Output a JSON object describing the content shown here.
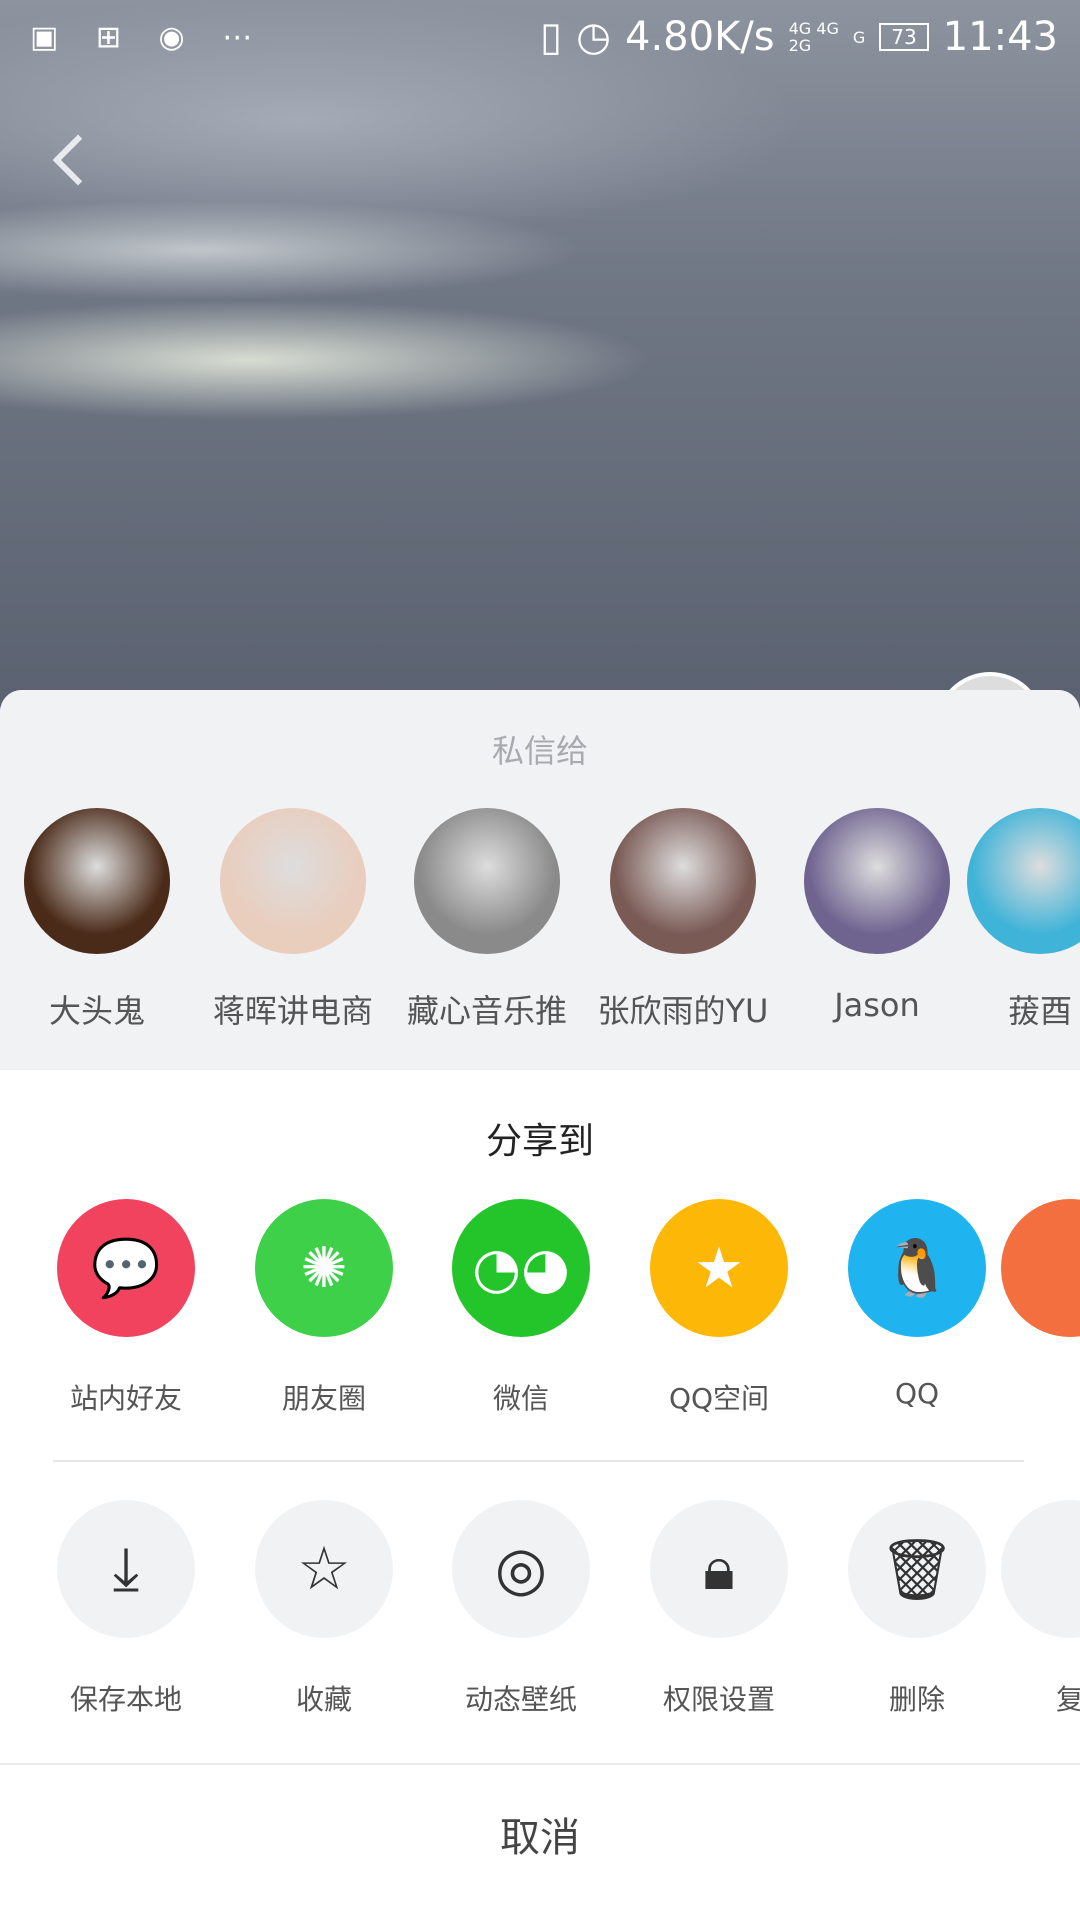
{
  "status_bar": {
    "left_icons": [
      "image-icon",
      "apps-icon",
      "record-icon",
      "more-icon"
    ],
    "speed": "4.80K/s",
    "net1": "4G 4G",
    "net2": "2G",
    "sim2": "G",
    "battery": "73",
    "time": "11:43"
  },
  "dm": {
    "title": "私信给",
    "contacts": [
      {
        "name": "大头鬼",
        "color": "#4a2a18"
      },
      {
        "name": "蒋晖讲电商",
        "color": "#e9cdbd"
      },
      {
        "name": "藏心音乐推",
        "color": "#8a8a8a"
      },
      {
        "name": "张欣雨的YU",
        "color": "#7a5a55"
      },
      {
        "name": "Jason",
        "color": "#6f6490"
      },
      {
        "name": "菝酉",
        "color": "#3fb3d8"
      }
    ]
  },
  "share": {
    "title": "分享到",
    "items": [
      {
        "label": "站内好友",
        "color": "#f2435e",
        "icon": "chat-bubble-icon"
      },
      {
        "label": "朋友圈",
        "color": "#3fd04a",
        "icon": "moments-icon"
      },
      {
        "label": "微信",
        "color": "#23c52b",
        "icon": "wechat-icon"
      },
      {
        "label": "QQ空间",
        "color": "#fdb707",
        "icon": "qzone-star-icon"
      },
      {
        "label": "QQ",
        "color": "#1fb4ef",
        "icon": "qq-penguin-icon"
      },
      {
        "label": "",
        "color": "#f36f3f",
        "icon": "weibo-icon"
      }
    ]
  },
  "actions": {
    "items": [
      {
        "label": "保存本地",
        "icon": "download-icon"
      },
      {
        "label": "收藏",
        "icon": "star-icon"
      },
      {
        "label": "动态壁纸",
        "icon": "live-wallpaper-icon"
      },
      {
        "label": "权限设置",
        "icon": "lock-icon"
      },
      {
        "label": "删除",
        "icon": "trash-icon"
      },
      {
        "label": "复",
        "icon": "copy-icon"
      }
    ]
  },
  "cancel_label": "取消"
}
